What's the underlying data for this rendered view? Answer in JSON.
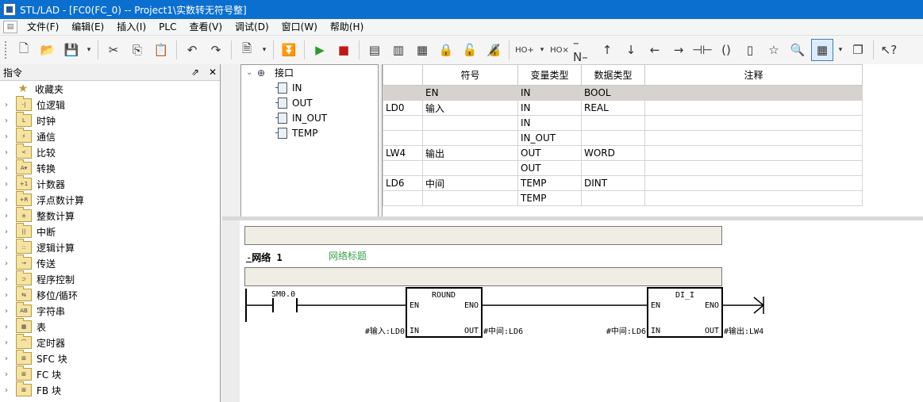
{
  "window": {
    "title": "STL/LAD - [FC0(FC_0) -- Project1\\实数转无符号整]"
  },
  "menu": {
    "items": [
      "文件(F)",
      "编辑(E)",
      "插入(I)",
      "PLC",
      "查看(V)",
      "调试(D)",
      "窗口(W)",
      "帮助(H)"
    ]
  },
  "instructions_pane": {
    "title": "指令",
    "pin_label": "⇗",
    "close_label": "✕",
    "favorites": "收藏夹",
    "items": [
      "位逻辑",
      "时钟",
      "通信",
      "比较",
      "转换",
      "计数器",
      "浮点数计算",
      "整数计算",
      "中断",
      "逻辑计算",
      "传送",
      "程序控制",
      "移位/循环",
      "字符串",
      "表",
      "定时器",
      "SFC 块",
      "FC 块",
      "FB 块"
    ],
    "icon_glyphs": [
      "-|",
      "L",
      "⚡",
      "<",
      "A▾",
      "+1",
      "+R",
      "±",
      "||",
      "::",
      "→",
      "⊃",
      "⇆",
      "AB",
      "▦",
      "⌒",
      "⊞",
      "⊞",
      "⊞"
    ]
  },
  "interface_tree": {
    "root": "接口",
    "children": [
      "IN",
      "OUT",
      "IN_OUT",
      "TEMP"
    ]
  },
  "var_table": {
    "headers": [
      "",
      "符号",
      "变量类型",
      "数据类型",
      "注释"
    ],
    "rows": [
      [
        "",
        "EN",
        "IN",
        "BOOL",
        ""
      ],
      [
        "LD0",
        "输入",
        "IN",
        "REAL",
        ""
      ],
      [
        "",
        "",
        "IN",
        "",
        ""
      ],
      [
        "",
        "",
        "IN_OUT",
        "",
        ""
      ],
      [
        "LW4",
        "输出",
        "OUT",
        "WORD",
        ""
      ],
      [
        "",
        "",
        "OUT",
        "",
        ""
      ],
      [
        "LD6",
        "中间",
        "TEMP",
        "DINT",
        ""
      ],
      [
        "",
        "",
        "TEMP",
        "",
        ""
      ]
    ]
  },
  "network": {
    "collapse": "-",
    "title": "网络 1",
    "label": "网络标题",
    "contact": "SM0.0",
    "box1": {
      "name": "ROUND",
      "en": "EN",
      "eno": "ENO",
      "in": "IN",
      "out": "OUT",
      "in_param": "#输入:LD0",
      "out_param": "#中间:LD6"
    },
    "box2": {
      "name": "DI_I",
      "en": "EN",
      "eno": "ENO",
      "in": "IN",
      "out": "OUT",
      "in_param": "#中间:LD6",
      "out_param": "#输出:LW4"
    }
  }
}
